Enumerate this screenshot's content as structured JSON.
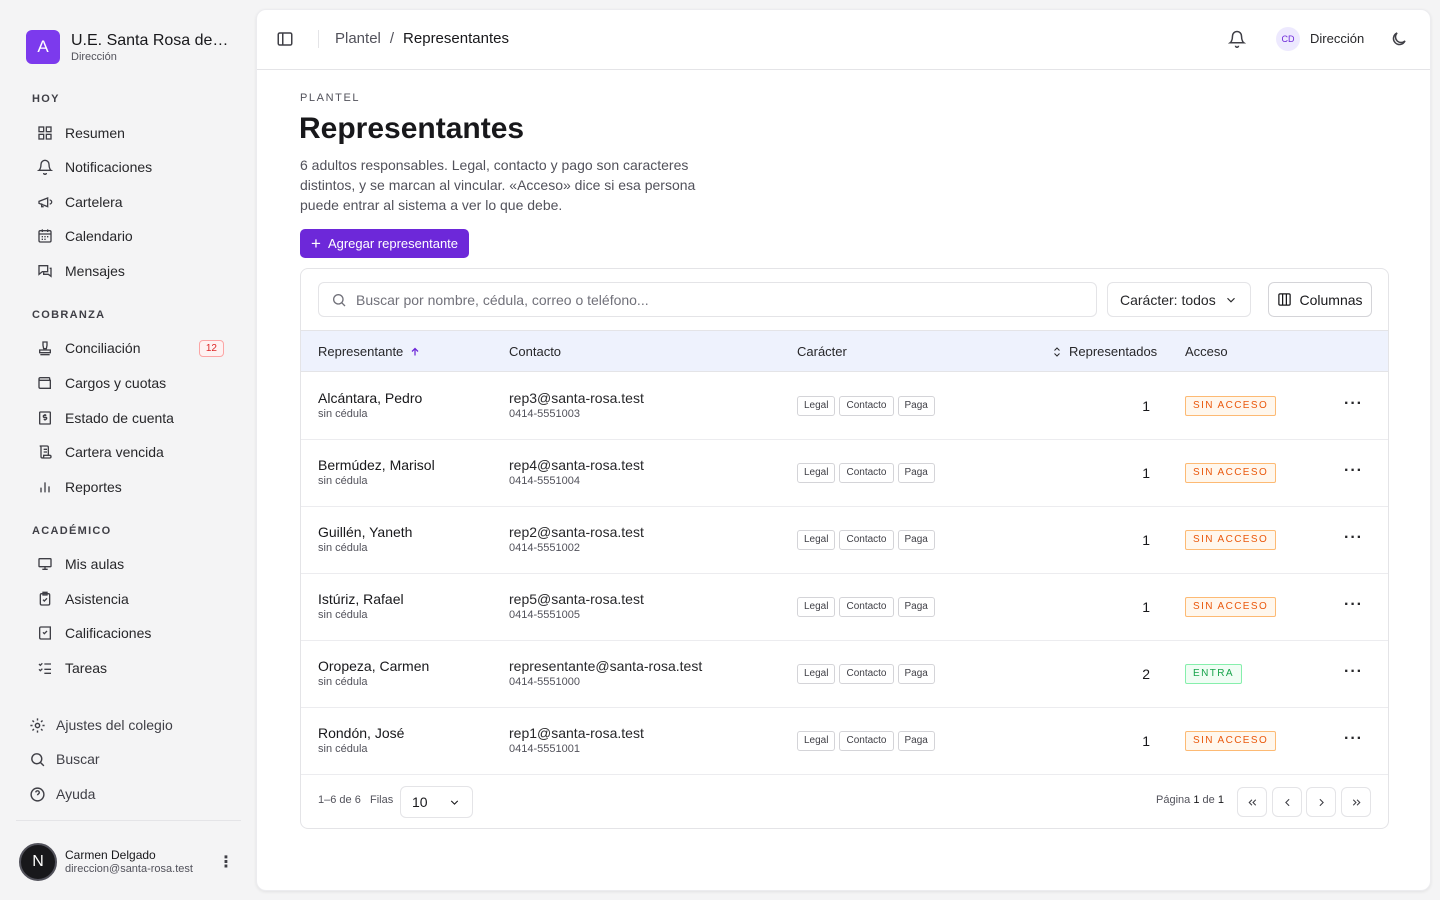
{
  "brand": {
    "logo_letter": "A",
    "name": "U.E. Santa Rosa de Lima",
    "role": "Dirección",
    "accent": "#7c3aed"
  },
  "sidebar": {
    "sections": [
      {
        "label": "HOY",
        "items": [
          {
            "label": "Resumen",
            "icon": "grid-icon"
          },
          {
            "label": "Notificaciones",
            "icon": "bell-icon"
          },
          {
            "label": "Cartelera",
            "icon": "megaphone-icon"
          },
          {
            "label": "Calendario",
            "icon": "calendar-icon"
          },
          {
            "label": "Mensajes",
            "icon": "messages-icon"
          }
        ]
      },
      {
        "label": "COBRANZA",
        "items": [
          {
            "label": "Conciliación",
            "icon": "stamp-icon",
            "badge": "12"
          },
          {
            "label": "Cargos y cuotas",
            "icon": "wallet-icon"
          },
          {
            "label": "Estado de cuenta",
            "icon": "dollar-receipt-icon"
          },
          {
            "label": "Cartera vencida",
            "icon": "scroll-icon"
          },
          {
            "label": "Reportes",
            "icon": "bar-chart-icon"
          }
        ]
      },
      {
        "label": "ACADÉMICO",
        "items": [
          {
            "label": "Mis aulas",
            "icon": "presentation-icon"
          },
          {
            "label": "Asistencia",
            "icon": "clipboard-check-icon"
          },
          {
            "label": "Calificaciones",
            "icon": "book-check-icon"
          },
          {
            "label": "Tareas",
            "icon": "list-check-icon"
          }
        ]
      }
    ],
    "footer": [
      {
        "label": "Ajustes del colegio",
        "icon": "gear-icon"
      },
      {
        "label": "Buscar",
        "icon": "search-icon"
      },
      {
        "label": "Ayuda",
        "icon": "help-icon"
      }
    ],
    "user": {
      "initial": "N",
      "name": "Carmen Delgado",
      "email": "direccion@santa-rosa.test"
    }
  },
  "topbar": {
    "breadcrumb": [
      "Plantel",
      "Representantes"
    ],
    "separator": "/",
    "user_initials": "CD",
    "user_label": "Dirección"
  },
  "page": {
    "eyebrow": "PLANTEL",
    "title": "Representantes",
    "description": "6 adultos responsables. Legal, contacto y pago son caracteres distintos, y se marcan al vincular. «Acceso» dice si esa persona puede entrar al sistema a ver lo que debe.",
    "add_button": "Agregar representante"
  },
  "toolbar": {
    "search_placeholder": "Buscar por nombre, cédula, correo o teléfono...",
    "filter": "Carácter: todos",
    "columns_button": "Columnas"
  },
  "table": {
    "headers": {
      "name": "Representante",
      "contact": "Contacto",
      "role": "Carácter",
      "count": "Representados",
      "access": "Acceso"
    },
    "rows": [
      {
        "name": "Alcántara, Pedro",
        "id": "sin cédula",
        "email": "rep3@santa-rosa.test",
        "phone": "0414-5551003",
        "tags": [
          "Legal",
          "Contacto",
          "Paga"
        ],
        "count": "1",
        "access": "SIN ACCESO",
        "access_ok": false
      },
      {
        "name": "Bermúdez, Marisol",
        "id": "sin cédula",
        "email": "rep4@santa-rosa.test",
        "phone": "0414-5551004",
        "tags": [
          "Legal",
          "Contacto",
          "Paga"
        ],
        "count": "1",
        "access": "SIN ACCESO",
        "access_ok": false
      },
      {
        "name": "Guillén, Yaneth",
        "id": "sin cédula",
        "email": "rep2@santa-rosa.test",
        "phone": "0414-5551002",
        "tags": [
          "Legal",
          "Contacto",
          "Paga"
        ],
        "count": "1",
        "access": "SIN ACCESO",
        "access_ok": false
      },
      {
        "name": "Istúriz, Rafael",
        "id": "sin cédula",
        "email": "rep5@santa-rosa.test",
        "phone": "0414-5551005",
        "tags": [
          "Legal",
          "Contacto",
          "Paga"
        ],
        "count": "1",
        "access": "SIN ACCESO",
        "access_ok": false
      },
      {
        "name": "Oropeza, Carmen",
        "id": "sin cédula",
        "email": "representante@santa-rosa.test",
        "phone": "0414-5551000",
        "tags": [
          "Legal",
          "Contacto",
          "Paga"
        ],
        "count": "2",
        "access": "ENTRA",
        "access_ok": true
      },
      {
        "name": "Rondón, José",
        "id": "sin cédula",
        "email": "rep1@santa-rosa.test",
        "phone": "0414-5551001",
        "tags": [
          "Legal",
          "Contacto",
          "Paga"
        ],
        "count": "1",
        "access": "SIN ACCESO",
        "access_ok": false
      }
    ]
  },
  "pagination": {
    "range": "1–6 de 6",
    "rows_label": "Filas",
    "rows_value": "10",
    "page_prefix": "Página",
    "page": "1",
    "page_mid": "de",
    "total": "1"
  }
}
